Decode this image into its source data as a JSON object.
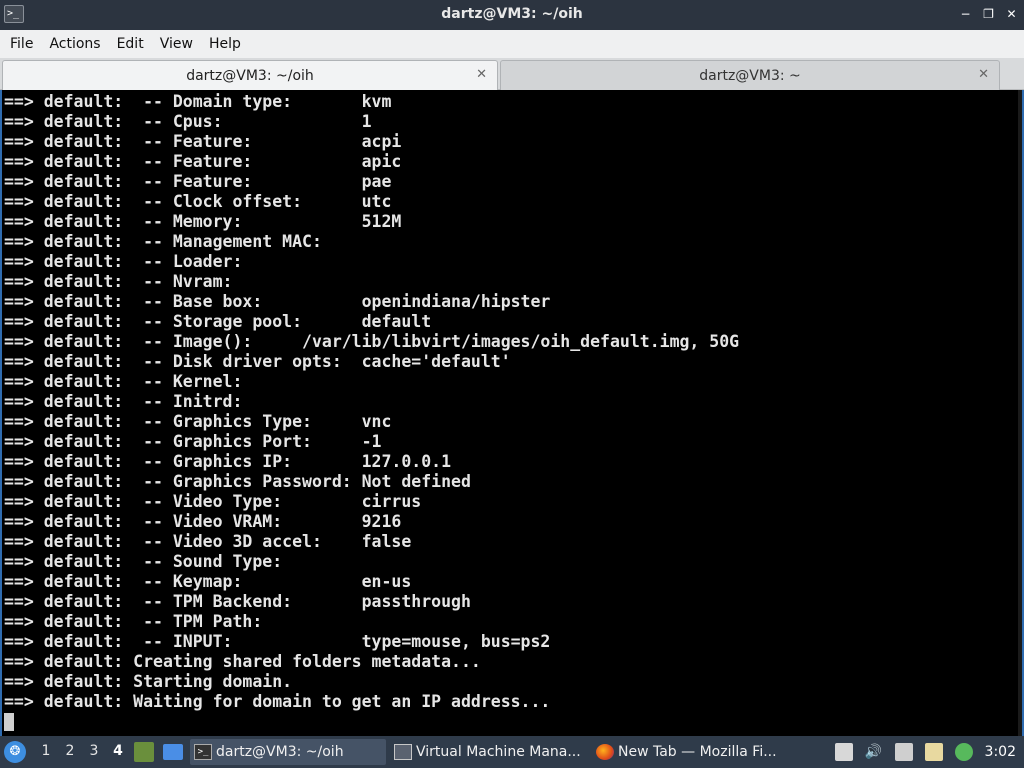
{
  "window": {
    "title": "dartz@VM3: ~/oih",
    "controls": {
      "minimize": "−",
      "maximize": "❐",
      "close": "✕"
    }
  },
  "menu": [
    "File",
    "Actions",
    "Edit",
    "View",
    "Help"
  ],
  "tabs": [
    {
      "label": "dartz@VM3: ~/oih",
      "close": "✕"
    },
    {
      "label": "dartz@VM3: ~",
      "close": "✕"
    }
  ],
  "terminal": {
    "lines": [
      "==> default:  -- Domain type:       kvm",
      "==> default:  -- Cpus:              1",
      "==> default:  -- Feature:           acpi",
      "==> default:  -- Feature:           apic",
      "==> default:  -- Feature:           pae",
      "==> default:  -- Clock offset:      utc",
      "==> default:  -- Memory:            512M",
      "==> default:  -- Management MAC:",
      "==> default:  -- Loader:",
      "==> default:  -- Nvram:",
      "==> default:  -- Base box:          openindiana/hipster",
      "==> default:  -- Storage pool:      default",
      "==> default:  -- Image():     /var/lib/libvirt/images/oih_default.img, 50G",
      "==> default:  -- Disk driver opts:  cache='default'",
      "==> default:  -- Kernel:",
      "==> default:  -- Initrd:",
      "==> default:  -- Graphics Type:     vnc",
      "==> default:  -- Graphics Port:     -1",
      "==> default:  -- Graphics IP:       127.0.0.1",
      "==> default:  -- Graphics Password: Not defined",
      "==> default:  -- Video Type:        cirrus",
      "==> default:  -- Video VRAM:        9216",
      "==> default:  -- Video 3D accel:    false",
      "==> default:  -- Sound Type:",
      "==> default:  -- Keymap:            en-us",
      "==> default:  -- TPM Backend:       passthrough",
      "==> default:  -- TPM Path:",
      "==> default:  -- INPUT:             type=mouse, bus=ps2",
      "==> default: Creating shared folders metadata...",
      "==> default: Starting domain.",
      "==> default: Waiting for domain to get an IP address..."
    ]
  },
  "taskbar": {
    "workspaces": [
      "1",
      "2",
      "3",
      "4"
    ],
    "active_workspace": "4",
    "tasks": [
      {
        "label": "dartz@VM3: ~/oih",
        "icon": "terminal-icon"
      },
      {
        "label": "Virtual Machine Mana...",
        "icon": "virt-manager-icon"
      },
      {
        "label": "New Tab — Mozilla Fi...",
        "icon": "firefox-icon"
      }
    ],
    "volume_glyph": "🔊",
    "clock": "3:02"
  }
}
